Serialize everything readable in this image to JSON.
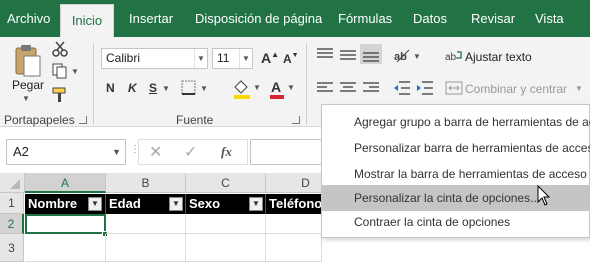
{
  "tabs": [
    "Archivo",
    "Inicio",
    "Insertar",
    "Disposición de página",
    "Fórmulas",
    "Datos",
    "Revisar",
    "Vista"
  ],
  "ribbon": {
    "paste_label": "Pegar",
    "clipboard_label": "Portapapeles",
    "font_name": "Calibri",
    "font_size": "11",
    "font_group_label": "Fuente",
    "bold": "N",
    "italic": "K",
    "underline": "S",
    "wrap_text": "Ajustar texto",
    "merge_center": "Combinar y centrar"
  },
  "formula_bar": {
    "name_box": "A2",
    "fx": "fx"
  },
  "grid": {
    "columns": [
      "A",
      "B",
      "C",
      "D"
    ],
    "rows": [
      "1",
      "2",
      "3"
    ],
    "headers": [
      "Nombre",
      "Edad",
      "Sexo",
      "Teléfono"
    ]
  },
  "context_menu": {
    "items": [
      "Agregar grupo a barra de herramientas de acceso rápido",
      "Personalizar barra de herramientas de acceso rápido...",
      "Mostrar la barra de herramientas de acceso rápido debajo de la cinta",
      "Personalizar la cinta de opciones...",
      "Contraer la cinta de opciones"
    ]
  },
  "colors": {
    "accent": "#217346",
    "font_color": "#d9262e",
    "fill_color": "#ffd700"
  },
  "icons": [
    "cut-icon",
    "copy-icon",
    "format-painter-icon",
    "paste-icon",
    "fill-color-icon",
    "font-color-icon",
    "wrap-text-icon",
    "merge-icon",
    "cancel-icon",
    "enter-icon",
    "mouse-cursor-icon"
  ]
}
